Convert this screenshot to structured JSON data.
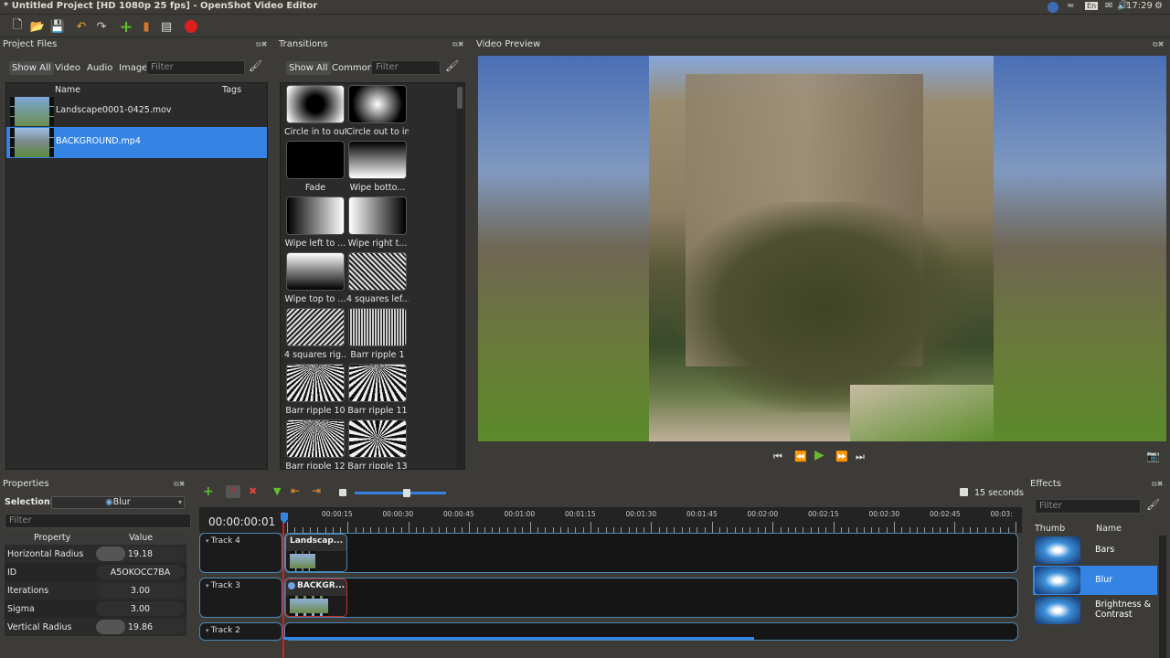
{
  "window": {
    "title": "* Untitled Project [HD 1080p 25 fps] - OpenShot Video Editor",
    "clock": "17:29",
    "keyboard": "En"
  },
  "project_files": {
    "title": "Project Files",
    "filters": [
      "Show All",
      "Video",
      "Audio",
      "Image"
    ],
    "filter_placeholder": "Filter",
    "col_name": "Name",
    "col_tags": "Tags",
    "files": [
      {
        "name": "Landscape0001-0425.mov"
      },
      {
        "name": "BACKGROUND.mp4"
      }
    ]
  },
  "transitions": {
    "title": "Transitions",
    "filters": [
      "Show All",
      "Common"
    ],
    "filter_placeholder": "Filter",
    "items": [
      "Circle in to out",
      "Circle out to in",
      "Fade",
      "Wipe botto...",
      "Wipe left to ...",
      "Wipe right t...",
      "Wipe top to ...",
      "4 squares lef...",
      "4 squares rig...",
      "Barr ripple 1",
      "Barr ripple 10",
      "Barr ripple 11",
      "Barr ripple 12",
      "Barr ripple 13"
    ]
  },
  "preview": {
    "title": "Video Preview"
  },
  "properties": {
    "title": "Properties",
    "selection_label": "Selection:",
    "selection_value": "Blur",
    "filter_placeholder": "Filter",
    "col_property": "Property",
    "col_value": "Value",
    "rows": [
      {
        "name": "Horizontal Radius",
        "value": "19.18",
        "fill": 0.33
      },
      {
        "name": "ID",
        "value": "A5OKOCC7BA",
        "fill": 0
      },
      {
        "name": "Iterations",
        "value": "3.00",
        "fill": 0
      },
      {
        "name": "Sigma",
        "value": "3.00",
        "fill": 0
      },
      {
        "name": "Vertical Radius",
        "value": "19.86",
        "fill": 0.33
      }
    ]
  },
  "timeline": {
    "timecode": "00:00:00:01",
    "zoom_label": "15 seconds",
    "zoom_fraction": 0.57,
    "ruler": [
      "00:00:15",
      "00:00:30",
      "00:00:45",
      "00:01:00",
      "00:01:15",
      "00:01:30",
      "00:01:45",
      "00:02:00",
      "00:02:15",
      "00:02:30",
      "00:02:45",
      "00:03:"
    ],
    "tracks": [
      {
        "name": "Track 4",
        "clip": "Landscap..."
      },
      {
        "name": "Track 3",
        "clip": "BACKGR..."
      },
      {
        "name": "Track 2",
        "clip": ""
      }
    ]
  },
  "effects": {
    "title": "Effects",
    "filter_placeholder": "Filter",
    "col_thumb": "Thumb",
    "col_name": "Name",
    "items": [
      "Bars",
      "Blur",
      "Brightness & Contrast"
    ]
  },
  "colors": {
    "selection": "#3584e4",
    "panel": "#2b2b2b",
    "chrome": "#3c3b37"
  }
}
